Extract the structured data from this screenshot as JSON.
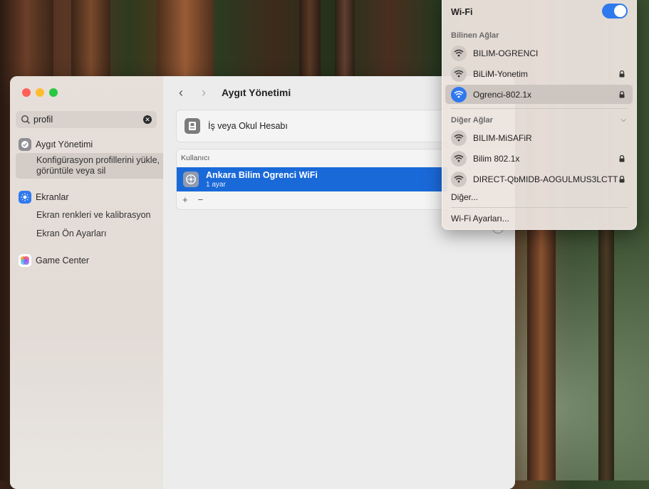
{
  "sidebar": {
    "search_value": "profil",
    "items": [
      {
        "label": "Aygıt Yönetimi",
        "icon": "gear-check-icon",
        "color": "#8e8e93"
      },
      {
        "label": "Ekranlar",
        "icon": "display-icon",
        "color": "#2f79ee"
      },
      {
        "label": "Game Center",
        "icon": "game-center-icon",
        "color": "#e84a8c"
      }
    ],
    "subitems": {
      "device_mgmt": "Konfigürasyon profillerini yükle, görüntüle veya sil",
      "display_colors": "Ekran renkleri ve kalibrasyon",
      "display_presets": "Ekran Ön Ayarları"
    }
  },
  "main": {
    "title": "Aygıt Yönetimi",
    "account_label": "İş veya Okul Hesabı",
    "users_header": "Kullanıcı",
    "profile": {
      "name": "Ankara Bilim Ogrenci WiFi",
      "sub": "1 ayar"
    },
    "add_symbol": "+",
    "remove_symbol": "−",
    "info_symbol": "i"
  },
  "wifi": {
    "title": "Wi-Fi",
    "enabled": true,
    "known_label": "Bilinen Ağlar",
    "known": [
      {
        "name": "BILIM-OGRENCI",
        "locked": false,
        "active": false
      },
      {
        "name": "BiLiM-Yonetim",
        "locked": true,
        "active": false
      },
      {
        "name": "Ogrenci-802.1x",
        "locked": true,
        "active": true
      }
    ],
    "other_label": "Diğer Ağlar",
    "other": [
      {
        "name": "BILIM-MiSAFiR",
        "locked": false
      },
      {
        "name": "Bilim 802.1x",
        "locked": true
      },
      {
        "name": "DIRECT-QbMIDB-AOGULMUS3LCTT",
        "locked": true
      }
    ],
    "other_link": "Diğer...",
    "settings_link": "Wi-Fi Ayarları..."
  }
}
